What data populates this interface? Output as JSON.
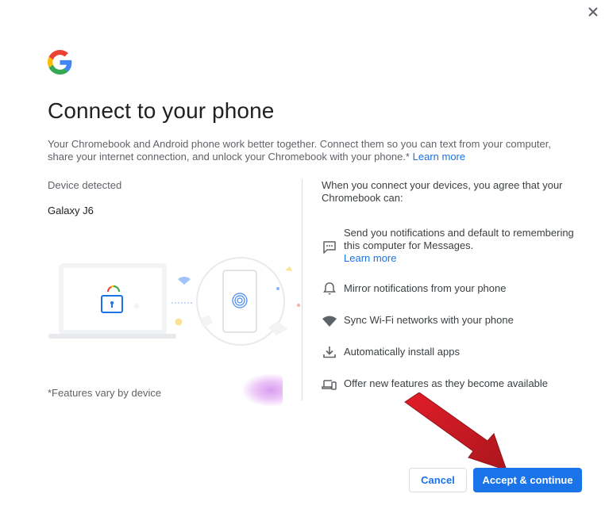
{
  "dialog": {
    "close_label": "×",
    "title": "Connect to your phone",
    "description": "Your Chromebook and Android phone work better together. Connect them so you can text from your computer, share your internet connection, and unlock your Chromebook with your phone.*",
    "learn_more": "Learn more"
  },
  "device": {
    "label": "Device detected",
    "name": "Galaxy J6"
  },
  "features_note": "*Features vary by device",
  "agreement": {
    "intro": "When you connect your devices, you agree that your Chromebook can:",
    "permissions": [
      {
        "icon": "message-icon",
        "text": "Send you notifications and default to remembering this computer for Messages.",
        "link": "Learn more"
      },
      {
        "icon": "bell-icon",
        "text": "Mirror notifications from your phone"
      },
      {
        "icon": "wifi-icon",
        "text": "Sync Wi-Fi networks with your phone"
      },
      {
        "icon": "download-icon",
        "text": "Automatically install apps"
      },
      {
        "icon": "devices-icon",
        "text": "Offer new features as they become available"
      }
    ]
  },
  "buttons": {
    "cancel": "Cancel",
    "accept": "Accept & continue"
  },
  "colors": {
    "accent": "#1a73e8",
    "arrow": "#d0101a"
  }
}
